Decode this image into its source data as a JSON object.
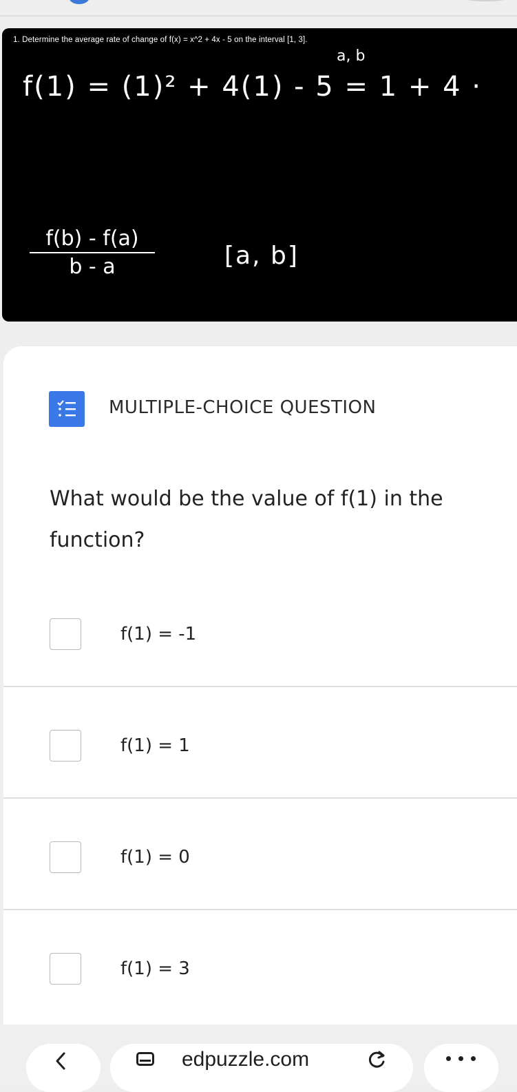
{
  "video": {
    "problem_text": "1. Determine the average rate of change of f(x) = x^2 + 4x - 5 on the interval [1, 3].",
    "annotation_ab": "a, b",
    "work_line_1": "f(1) = (1)² + 4(1) - 5 = 1 + 4 ·",
    "formula_numerator": "f(b) - f(a)",
    "formula_denominator": "b - a",
    "interval_note": "[a, b]"
  },
  "question": {
    "type_label": "MULTIPLE-CHOICE QUESTION",
    "type_icon": "checklist-icon",
    "accent_color": "#3b78e7",
    "prompt": "What would be the value of f(1) in the function?",
    "choices": [
      {
        "label": "f(1) = -1",
        "checked": false
      },
      {
        "label": "f(1) = 1",
        "checked": false
      },
      {
        "label": "f(1) = 0",
        "checked": false
      },
      {
        "label": "f(1) = 3",
        "checked": false
      }
    ]
  },
  "browser": {
    "url": "edpuzzle.com",
    "back_icon": "chevron-left-icon",
    "tabs_icon": "tab-switcher-icon",
    "reload_icon": "reload-icon",
    "more_icon": "more-options-icon"
  }
}
